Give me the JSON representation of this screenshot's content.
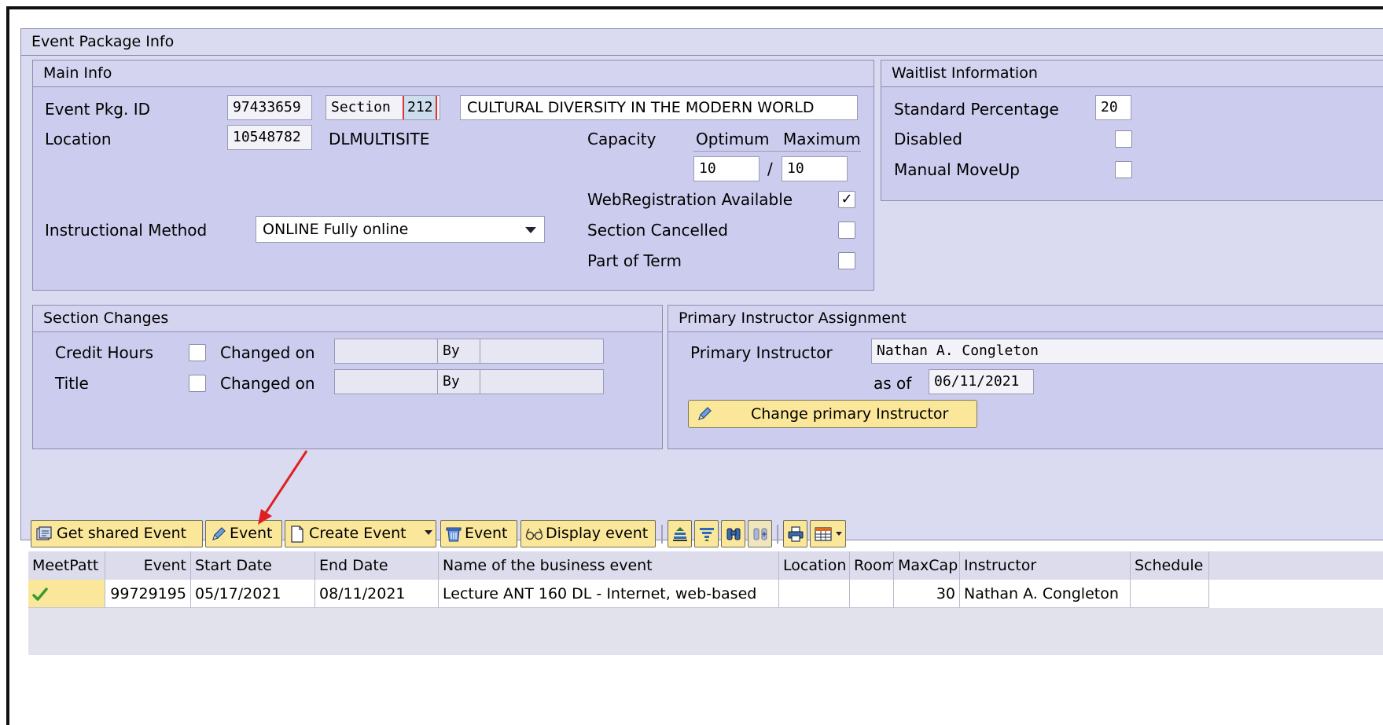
{
  "event_package": {
    "title": "Event Package Info",
    "main_info": {
      "title": "Main Info",
      "event_pkg_id_label": "Event Pkg. ID",
      "event_pkg_id": "97433659",
      "section_label": "Section",
      "section_value": "212",
      "section_title": "CULTURAL DIVERSITY IN THE MODERN WORLD",
      "location_label": "Location",
      "location_id": "10548782",
      "location_name": "DLMULTISITE",
      "capacity_label": "Capacity",
      "optimum_label": "Optimum",
      "maximum_label": "Maximum",
      "optimum_value": "10",
      "separator": "/",
      "maximum_value": "10",
      "web_registration_label": "WebRegistration Available",
      "web_registration_checked": true,
      "section_cancelled_label": "Section Cancelled",
      "part_of_term_label": "Part of Term",
      "instructional_method_label": "Instructional Method",
      "instructional_method_value": "ONLINE Fully online"
    },
    "waitlist": {
      "title": "Waitlist Information",
      "standard_percentage_label": "Standard Percentage",
      "standard_percentage_value": "20",
      "disabled_label": "Disabled",
      "manual_moveup_label": "Manual MoveUp"
    },
    "section_changes": {
      "title": "Section Changes",
      "credit_hours_label": "Credit Hours",
      "title_label": "Title",
      "changed_on_label": "Changed on",
      "by_label": "By"
    },
    "instructor": {
      "title": "Primary Instructor Assignment",
      "primary_instructor_label": "Primary Instructor",
      "primary_instructor_value": "Nathan A. Congleton",
      "as_of_label": "as of",
      "as_of_value": "06/11/2021",
      "change_button": "Change primary Instructor"
    }
  },
  "toolbar": {
    "get_shared_event": "Get shared Event",
    "edit_event": "Event",
    "create_event": "Create Event",
    "delete_event": "Event",
    "display_event": "Display event"
  },
  "grid": {
    "headers": [
      "MeetPatt",
      "Event",
      "Start Date",
      "End Date",
      "Name of the business event",
      "Location",
      "Room",
      "MaxCap",
      "Instructor",
      "Schedule"
    ],
    "rows": [
      {
        "meetpatt": "",
        "event": "99729195",
        "start_date": "05/17/2021",
        "end_date": "08/11/2021",
        "name": "Lecture ANT 160 DL - Internet, web-based",
        "location": "",
        "room": "",
        "maxcap": "30",
        "instructor": "Nathan A. Congleton",
        "schedule": ""
      }
    ]
  },
  "colors": {
    "group_bg": "#ccccee",
    "button_yellow": "#fbe79a",
    "annotation_arrow": "#e02020"
  }
}
